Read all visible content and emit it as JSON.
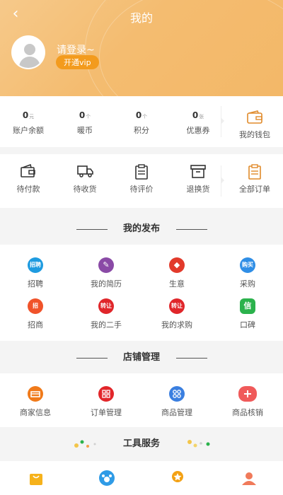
{
  "header": {
    "title": "我的",
    "login_text": "请登录~",
    "vip_label": "开通vip"
  },
  "stats": [
    {
      "value": "0",
      "unit": "元",
      "label": "账户余额"
    },
    {
      "value": "0",
      "unit": "个",
      "label": "暖币"
    },
    {
      "value": "0",
      "unit": "个",
      "label": "积分"
    },
    {
      "value": "0",
      "unit": "张",
      "label": "优惠券"
    }
  ],
  "wallet_label": "我的钱包",
  "orders": [
    {
      "label": "待付款",
      "icon": "wallet-icon"
    },
    {
      "label": "待收货",
      "icon": "truck-icon"
    },
    {
      "label": "待评价",
      "icon": "clipboard-icon"
    },
    {
      "label": "退换货",
      "icon": "box-icon"
    }
  ],
  "all_orders_label": "全部订单",
  "my_posts": {
    "title": "我的发布",
    "items": [
      {
        "label": "招聘",
        "icon_text": "招聘",
        "color": "#1e9be0"
      },
      {
        "label": "我的简历",
        "icon_text": "✎",
        "color": "#8a4aa6"
      },
      {
        "label": "生意",
        "icon_text": "◆",
        "color": "#e23a2b"
      },
      {
        "label": "采购",
        "icon_text": "购买",
        "color": "#2f8ee6"
      },
      {
        "label": "招商",
        "icon_text": "招",
        "color": "#f0532a"
      },
      {
        "label": "我的二手",
        "icon_text": "转让",
        "color": "#e0262a"
      },
      {
        "label": "我的求购",
        "icon_text": "转让",
        "color": "#e0262a"
      },
      {
        "label": "口碑",
        "icon_text": "信",
        "color": "#2bb24c"
      }
    ]
  },
  "shop": {
    "title": "店铺管理",
    "items": [
      {
        "label": "商家信息",
        "color": "#f07a1a"
      },
      {
        "label": "订单管理",
        "color": "#e2262a"
      },
      {
        "label": "商品管理",
        "color": "#3b7fe0"
      },
      {
        "label": "商品核销",
        "color": "#f05a5a"
      }
    ]
  },
  "tools": {
    "title": "工具服务"
  },
  "bottom_icons": [
    {
      "icon": "bag-icon",
      "color": "#f6b21b"
    },
    {
      "icon": "paw-icon",
      "color": "#2f9be6"
    },
    {
      "icon": "medal-icon",
      "color": "#f3a114"
    },
    {
      "icon": "people-icon",
      "color": "#f07a5a"
    }
  ]
}
